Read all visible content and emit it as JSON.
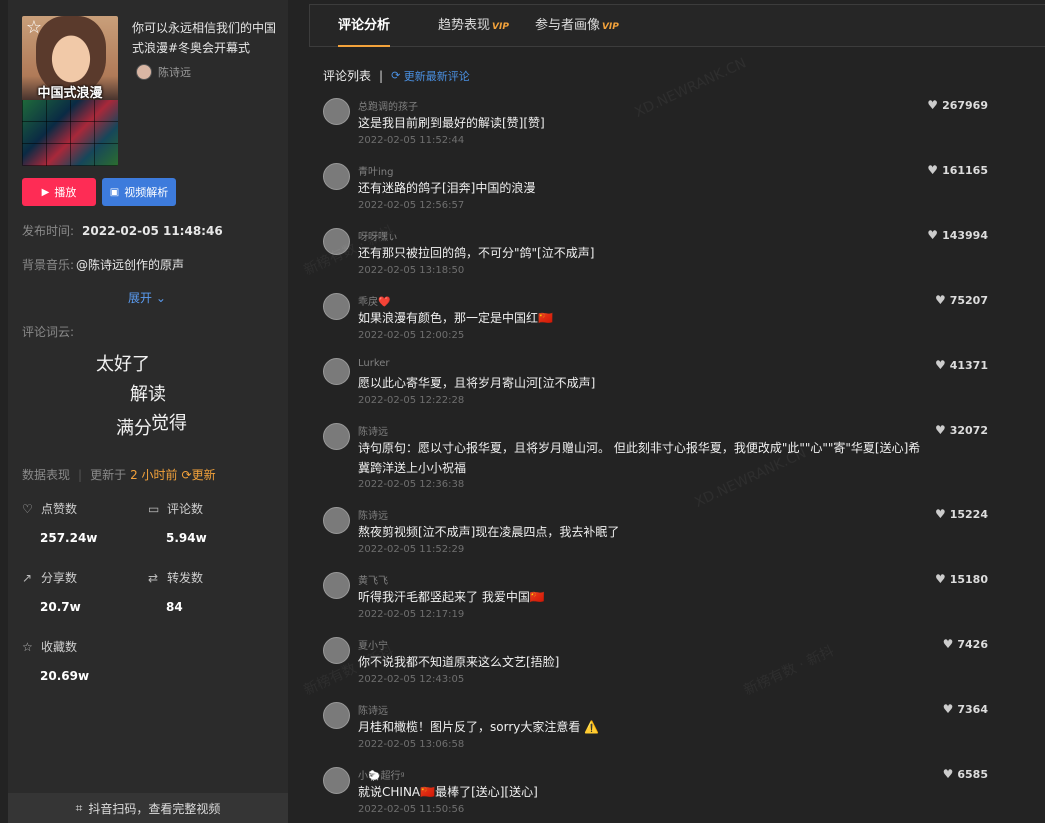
{
  "video": {
    "thumb_caption": "中国式浪漫",
    "title": "你可以永远相信我们的中国式浪漫#冬奥会开幕式",
    "author": "陈诗远",
    "play_label": "播放",
    "analyze_label": "视频解析",
    "publish_label": "发布时间:",
    "publish_time": "2022-02-05 11:48:46",
    "music_label": "背景音乐:",
    "music_value": "@陈诗远创作的原声",
    "expand_label": "展开"
  },
  "wordcloud": {
    "label": "评论词云:",
    "words": [
      "太好了",
      "解读",
      "满分",
      "觉得"
    ]
  },
  "stats": {
    "title": "数据表现",
    "updated_prefix": "更新于",
    "updated_ago": "2 小时前",
    "update_label": "更新",
    "likes_label": "点赞数",
    "likes": "257.24w",
    "comments_label": "评论数",
    "comments": "5.94w",
    "shares_label": "分享数",
    "shares": "20.7w",
    "reposts_label": "转发数",
    "reposts": "84",
    "favorites_label": "收藏数",
    "favorites": "20.69w"
  },
  "scan_label": "抖音扫码，查看完整视频",
  "tabs": [
    {
      "label": "评论分析",
      "vip": ""
    },
    {
      "label": "趋势表现",
      "vip": "VIP"
    },
    {
      "label": "参与者画像",
      "vip": "VIP"
    }
  ],
  "list": {
    "title": "评论列表",
    "refresh": "更新最新评论"
  },
  "comments": [
    {
      "user": "总跑调的孩子",
      "text": "这是我目前刷到最好的解读[赞][赞]",
      "time": "2022-02-05 11:52:44",
      "likes": "267969"
    },
    {
      "user": "青叶ing",
      "text": "还有迷路的鸽子[泪奔]中国的浪漫",
      "time": "2022-02-05 12:56:57",
      "likes": "161165"
    },
    {
      "user": "呀呀嘿ぃ",
      "text": "还有那只被拉回的鸽，不可分\"鸽\"[泣不成声]",
      "time": "2022-02-05 13:18:50",
      "likes": "143994"
    },
    {
      "user": "乖戾❤️",
      "text": "如果浪漫有颜色，那一定是中国红🇨🇳",
      "time": "2022-02-05 12:00:25",
      "likes": "75207"
    },
    {
      "user": "Lurker",
      "text": "愿以此心寄华夏，且将岁月寄山河[泣不成声]",
      "time": "2022-02-05 12:22:28",
      "likes": "41371"
    },
    {
      "user": "陈诗远",
      "text": "诗句原句：愿以寸心报华夏，且将岁月赠山河。 但此刻非寸心报华夏，我便改成\"此\"\"心\"\"寄\"华夏[送心]希冀跨洋送上小小祝福",
      "time": "2022-02-05 12:36:38",
      "likes": "32072"
    },
    {
      "user": "陈诗远",
      "text": "熬夜剪视频[泣不成声]现在凌晨四点，我去补眠了",
      "time": "2022-02-05 11:52:29",
      "likes": "15224"
    },
    {
      "user": "黄飞飞",
      "text": "听得我汗毛都竖起来了 我爱中国🇨🇳",
      "time": "2022-02-05 12:17:19",
      "likes": "15180"
    },
    {
      "user": "夏小宁",
      "text": "你不说我都不知道原来这么文艺[捂脸]",
      "time": "2022-02-05 12:43:05",
      "likes": "7426"
    },
    {
      "user": "陈诗远",
      "text": "月桂和橄榄！图片反了，sorry大家注意看 ⚠️",
      "time": "2022-02-05 13:06:58",
      "likes": "7364"
    },
    {
      "user": "小🐑超行ᵍ",
      "text": "就说CHINA🇨🇳最棒了[送心][送心]",
      "time": "2022-02-05 11:50:56",
      "likes": "6585"
    }
  ],
  "watermarks": [
    "XD.NEWRANK.CN",
    "新榜有数 · 新抖"
  ]
}
